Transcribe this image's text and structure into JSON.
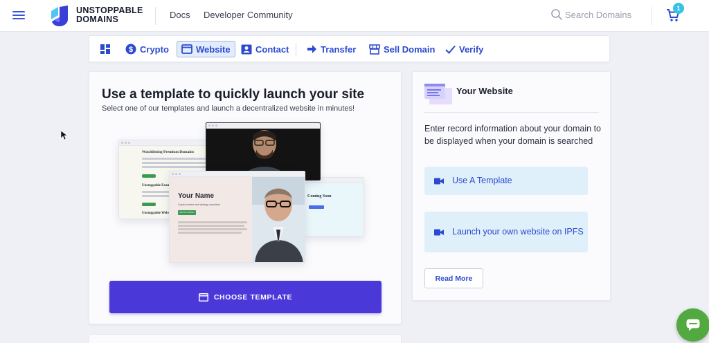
{
  "header": {
    "brand_line1": "UNSTOPPABLE",
    "brand_line2": "DOMAINS",
    "nav": [
      {
        "label": "Docs"
      },
      {
        "label": "Developer Community"
      }
    ],
    "search_placeholder": "Search Domains",
    "cart_count": "1"
  },
  "toolbar": {
    "items": [
      {
        "label": "",
        "icon": "dashboard-icon"
      },
      {
        "label": "Crypto",
        "icon": "dollar-circle-icon"
      },
      {
        "label": "Website",
        "icon": "browser-window-icon",
        "active": true
      },
      {
        "label": "Contact",
        "icon": "contact-card-icon"
      },
      {
        "label": "Transfer",
        "icon": "arrow-right-icon"
      },
      {
        "label": "Sell Domain",
        "icon": "storefront-icon"
      },
      {
        "label": "Verify",
        "icon": "checkmark-icon"
      }
    ]
  },
  "main": {
    "title": "Use a template to quickly launch your site",
    "subtitle": "Select one of our templates and launch a decentralized website in minutes!",
    "illustration": {
      "template1_heading": "Watchlisting Premium Domains",
      "template1_heading2": "Unstoppable Exam",
      "template1_heading3": "Unstoppable Webs",
      "template2_heading": "Your Name",
      "template2_caption": "Crypto investor and strategy consultant",
      "template2_button": "GET IN TOUCH",
      "template3_heading": "Coming Soon"
    },
    "choose_button": "CHOOSE TEMPLATE"
  },
  "sidebar_card": {
    "title": "Your Website",
    "description": "Enter record information about your domain to be displayed when your domain is searched",
    "options": [
      {
        "label": "Use A Template",
        "icon": "video-camera-icon"
      },
      {
        "label": "Launch your own website on IPFS",
        "icon": "video-camera-icon"
      }
    ],
    "read_more": "Read More"
  },
  "colors": {
    "accent": "#2c4ad0",
    "primary_button": "#4a39d8",
    "option_bg": "#e0f0fb",
    "chat_green": "#52a93f",
    "badge": "#34c3e3"
  }
}
